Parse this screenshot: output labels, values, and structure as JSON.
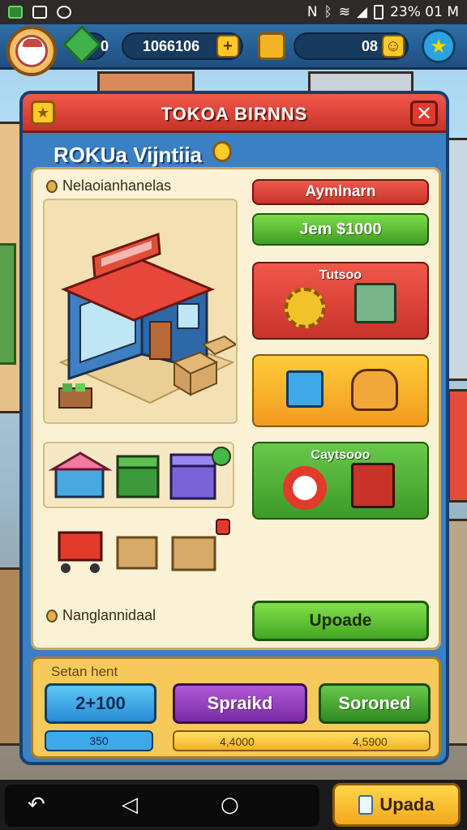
{
  "status_bar": {
    "time_text": "23% 01 M"
  },
  "resources": {
    "gems": "0",
    "coins": "1066106",
    "third": "08"
  },
  "dialog": {
    "title": "TOKOA BIRNNS",
    "subtitle": "ROKUa Vijntiia",
    "panel_label_top": "Nelaoianhanelas",
    "panel_label_bottom": "Nanglannidaal",
    "buttons": {
      "red_top": "Aymlnarn",
      "green_top": "Jem $1000",
      "upgrade": "Upoade"
    },
    "tiles": {
      "red_tile": "Tutsoo",
      "green_tile": "Caytsooo"
    }
  },
  "bottom": {
    "label": "Setan hent",
    "blue_button": "2+100",
    "purple_button": "Spraikd",
    "green_button": "Soroned",
    "blue_bar": "350",
    "yellow_bar_1": "4,4000",
    "yellow_bar_2": "4,5900"
  },
  "nav": {
    "action_button": "Upada"
  },
  "icons": [
    "back-icon",
    "home-icon",
    "recents-icon",
    "gem-icon",
    "star-icon",
    "close-icon",
    "coin-icon"
  ]
}
